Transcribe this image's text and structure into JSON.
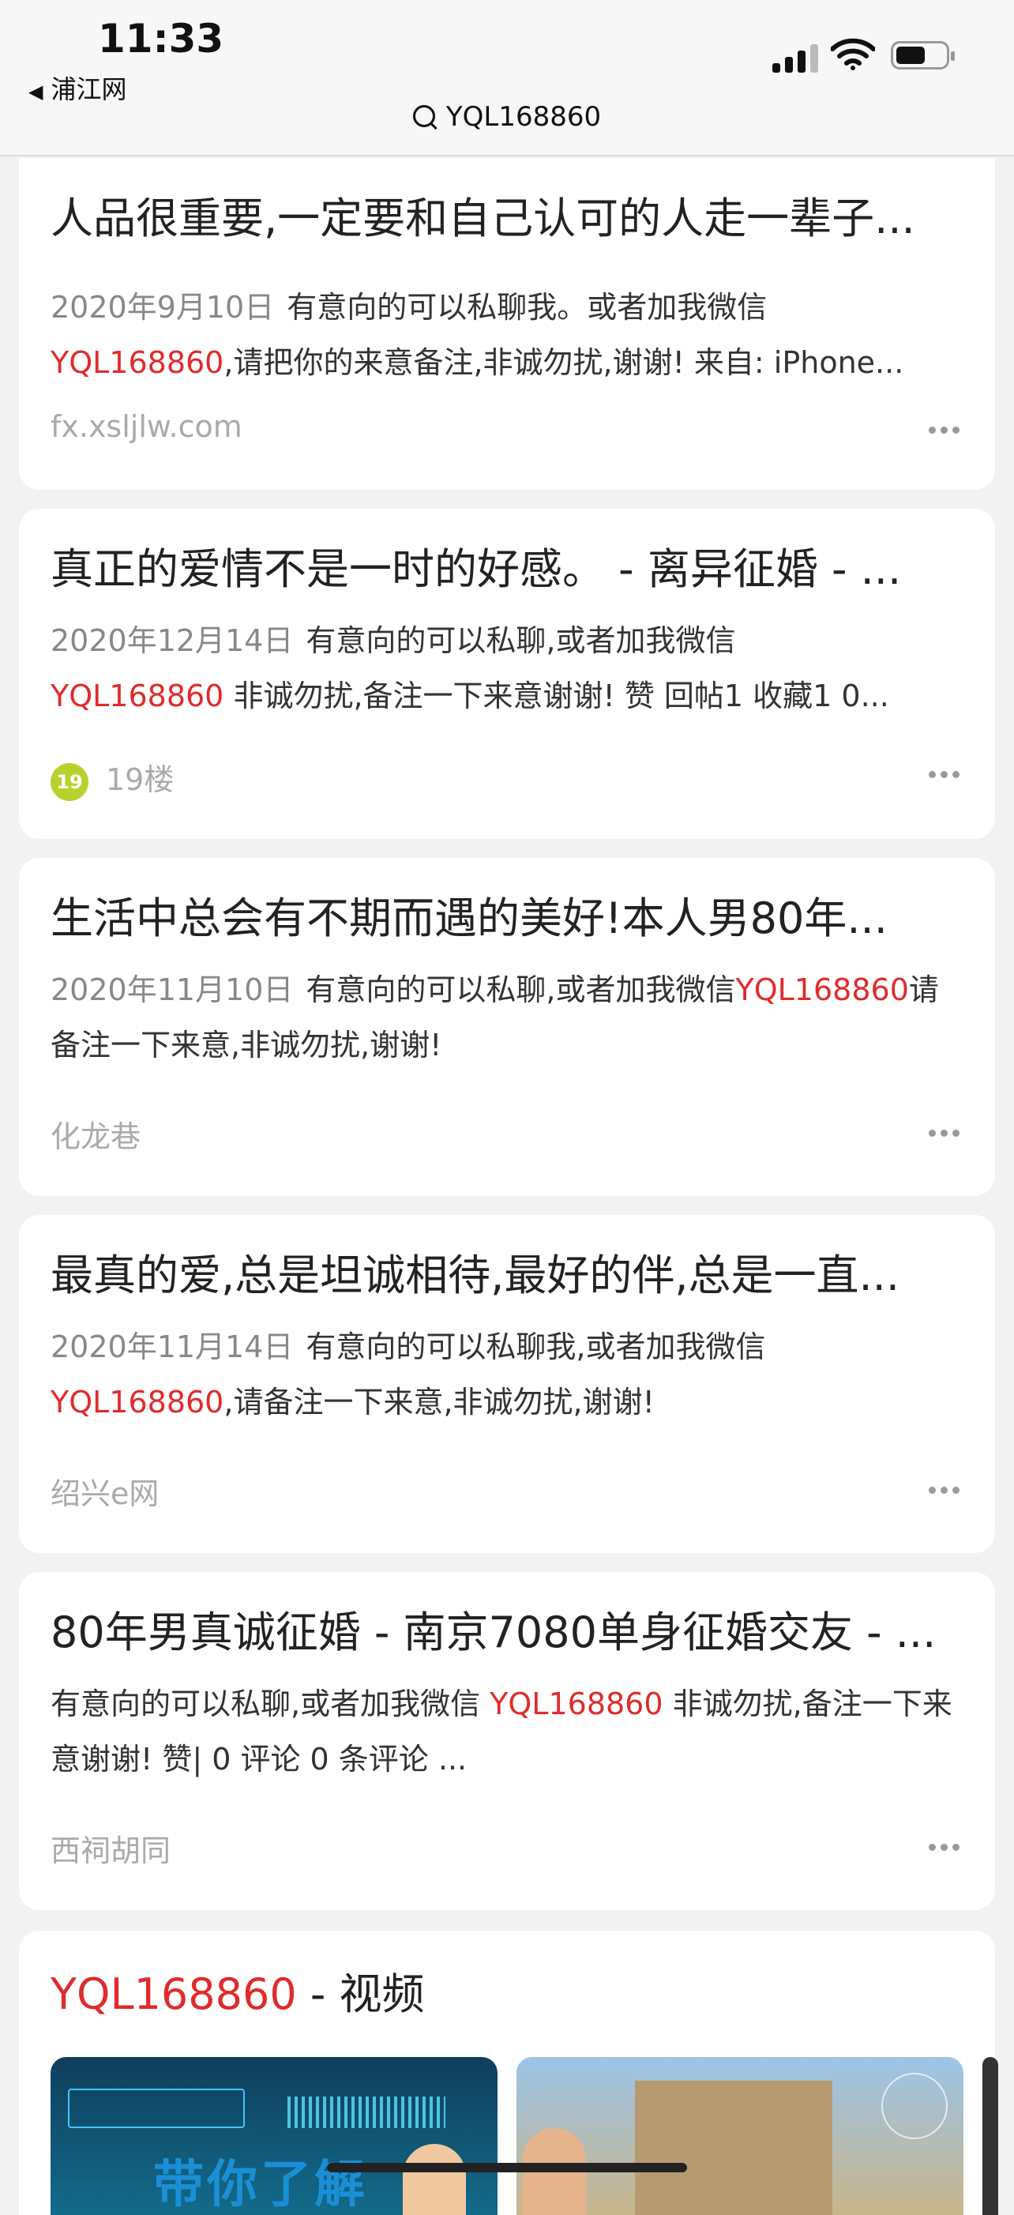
{
  "status_bar": {
    "time": "11:33",
    "back_app": "浦江网"
  },
  "address_bar": {
    "query": "YQL168860"
  },
  "results": [
    {
      "title": "人品很重要,一定要和自己认可的人走一辈子...",
      "date": "2020年9月10日",
      "snippet_pre": "有意向的可以私聊我。或者加我微信",
      "highlight": "YQL168860",
      "snippet_post": ",请把你的来意备注,非诚勿扰,谢谢! 来自: iPhone...",
      "source": "fx.xsljlw.com"
    },
    {
      "title": "真正的爱情不是一时的好感。 - 离异征婚 - ...",
      "date": "2020年12月14日",
      "snippet_pre": "有意向的可以私聊,或者加我微信",
      "highlight": "YQL168860",
      "snippet_post": " 非诚勿扰,备注一下来意谢谢! 赞 回帖1 收藏1 0...",
      "source": "19楼",
      "source_logo": "19"
    },
    {
      "title": "生活中总会有不期而遇的美好!本人男80年...",
      "date": "2020年11月10日",
      "snippet_pre": "有意向的可以私聊,或者加我微信",
      "highlight": "YQL168860",
      "snippet_post": "请备注一下来意,非诚勿扰,谢谢!",
      "source": "化龙巷"
    },
    {
      "title": "最真的爱,总是坦诚相待,最好的伴,总是一直...",
      "date": "2020年11月14日",
      "snippet_pre": "有意向的可以私聊我,或者加我微信",
      "highlight": "YQL168860",
      "snippet_post": ",请备注一下来意,非诚勿扰,谢谢!",
      "source": "绍兴e网"
    },
    {
      "title": "80年男真诚征婚 - 南京7080单身征婚交友 - ...",
      "date": "",
      "snippet_pre": "有意向的可以私聊,或者加我微信 ",
      "highlight": "YQL168860",
      "snippet_post": " 非诚勿扰,备注一下来意谢谢! 赞| 0 评论 0 条评论 ...",
      "source": "西祠胡同"
    }
  ],
  "video_section": {
    "title_highlight": "YQL168860",
    "title_rest": " - 视频",
    "thumb1_text": "带你了解"
  },
  "colors": {
    "highlight": "#e02b2b",
    "background": "#f2f2f2",
    "card": "#ffffff"
  }
}
